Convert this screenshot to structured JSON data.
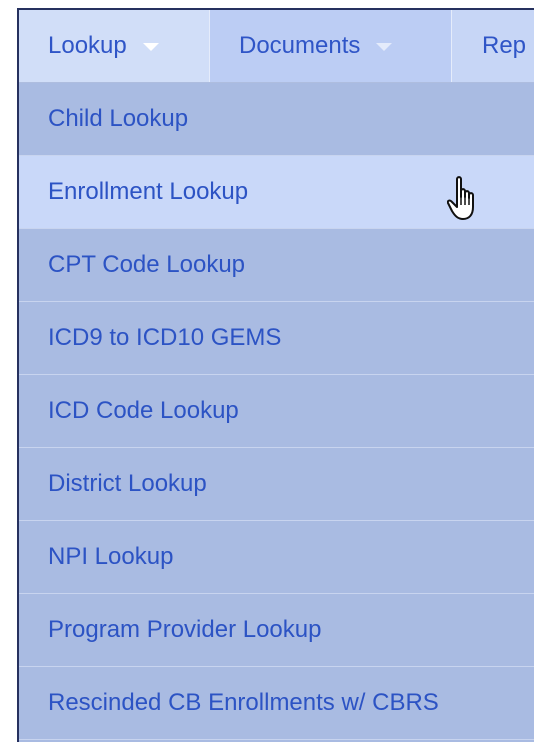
{
  "navbar": {
    "items": [
      {
        "label": "Lookup"
      },
      {
        "label": "Documents"
      },
      {
        "label": "Rep"
      }
    ]
  },
  "menu": {
    "items": [
      {
        "label": "Child Lookup"
      },
      {
        "label": "Enrollment Lookup"
      },
      {
        "label": "CPT Code Lookup"
      },
      {
        "label": "ICD9 to ICD10 GEMS"
      },
      {
        "label": "ICD Code Lookup"
      },
      {
        "label": "District Lookup"
      },
      {
        "label": "NPI Lookup"
      },
      {
        "label": "Program Provider Lookup"
      },
      {
        "label": "Rescinded CB Enrollments w/ CBRS"
      }
    ]
  },
  "icons": {
    "caret": "chevron-down-icon",
    "cursor": "hand-pointer-icon"
  },
  "colors": {
    "nav_text": "#2f55c7",
    "menu_bg": "#a9bbe2",
    "menu_hover_bg": "#c9d8f9"
  }
}
